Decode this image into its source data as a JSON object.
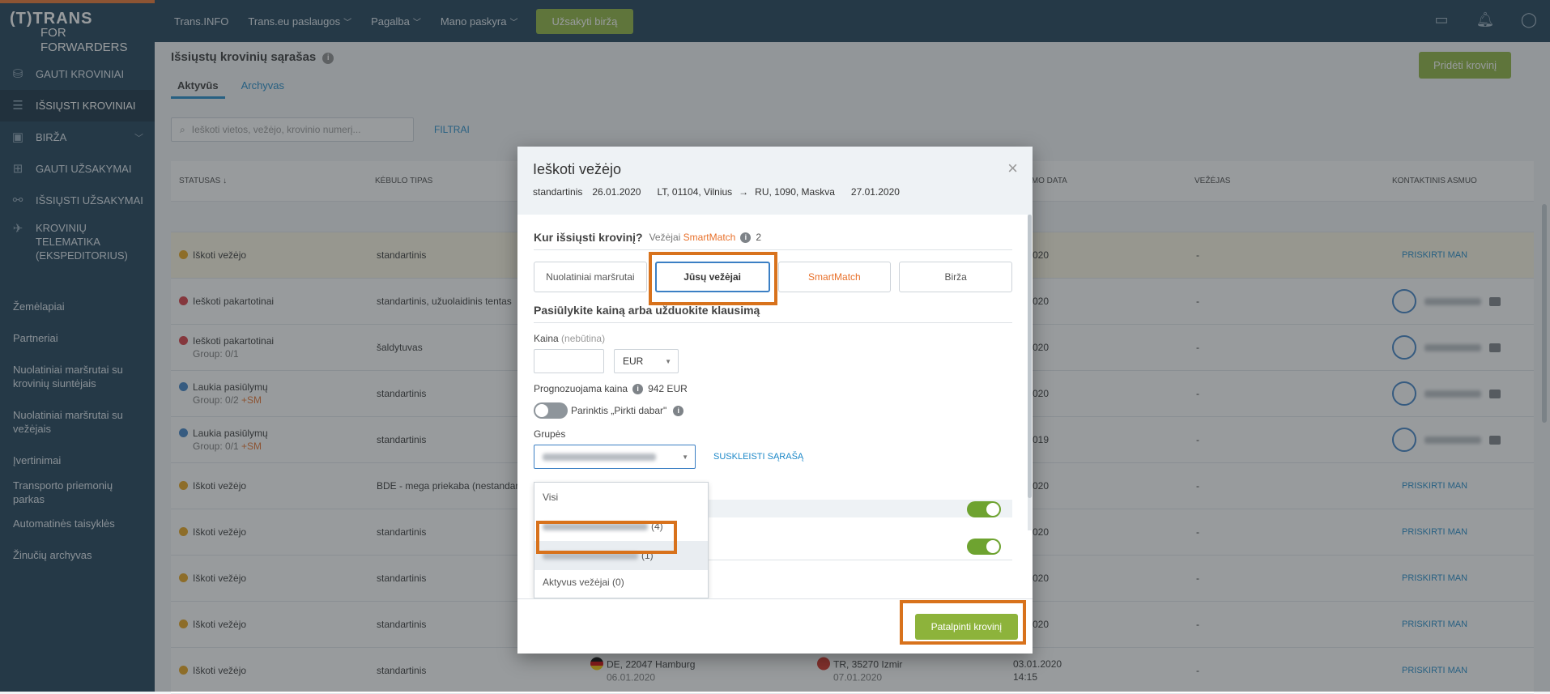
{
  "logo": {
    "line1": "(T)TRANS",
    "line2": "FOR FORWARDERS"
  },
  "topnav": {
    "items": [
      "Trans.INFO",
      "Trans.eu paslaugos",
      "Pagalba",
      "Mano paskyra"
    ],
    "order_button": "Užsakyti biržą"
  },
  "sidebar": {
    "main": [
      {
        "label": "GAUTI KROVINIAI",
        "icon": "inbox-icon"
      },
      {
        "label": "IŠSIŲSTI KROVINIAI",
        "icon": "send-icon"
      },
      {
        "label": "BIRŽA",
        "icon": "box-icon"
      },
      {
        "label": "GAUTI UŽSAKYMAI",
        "icon": "grid-icon"
      },
      {
        "label": "IŠSIŲSTI UŽSAKYMAI",
        "icon": "link-icon"
      },
      {
        "label": "KROVINIŲ TELEMATIKA (EKSPEDITORIUS)",
        "icon": "satellite-icon"
      }
    ],
    "secondary": [
      "Žemėlapiai",
      "Partneriai",
      "Nuolatiniai maršrutai su krovinių siuntėjais",
      "Nuolatiniai maršrutai su vežėjais",
      "Įvertinimai",
      "Transporto priemonių parkas",
      "Automatinės taisyklės",
      "Žinučių archyvas"
    ]
  },
  "page": {
    "title": "Išsiųstų krovinių sąrašas",
    "add_button": "Pridėti krovinį",
    "tabs": [
      "Aktyvūs",
      "Archyvas"
    ],
    "search_placeholder": "Ieškoti vietos, vežėjo, krovinio numerį...",
    "filters": "FILTRAI"
  },
  "table": {
    "headers": [
      "STATUSAS ↓",
      "KĖBULO TIPAS",
      "IMO DATA",
      "VEŽĖJAS",
      "KONTAKTINIS ASMUO"
    ],
    "rows": [
      {
        "status": "Iškoti vežėjo",
        "sub": "",
        "sm": "",
        "type": "standartinis",
        "date": "020",
        "carrier": "-",
        "contact": "PRISKIRTI MAN"
      },
      {
        "status": "Ieškoti pakartotinai",
        "sub": "",
        "sm": "",
        "type": "standartinis, užuolaidinis tentas",
        "date": "020",
        "carrier": "-",
        "contact": ""
      },
      {
        "status": "Ieškoti pakartotinai",
        "sub": "Group: 0/1",
        "sm": "",
        "type": "šaldytuvas",
        "date": "020",
        "carrier": "-",
        "contact": ""
      },
      {
        "status": "Laukia pasiūlymų",
        "sub": "Group: 0/2",
        "sm": "+SM",
        "type": "standartinis",
        "date": "020",
        "carrier": "-",
        "contact": ""
      },
      {
        "status": "Laukia pasiūlymų",
        "sub": "Group: 0/1",
        "sm": "+SM",
        "type": "standartinis",
        "date": "019",
        "carrier": "-",
        "contact": ""
      },
      {
        "status": "Iškoti vežėjo",
        "sub": "",
        "sm": "",
        "type": "BDE - mega priekaba (nestandar",
        "date": "020",
        "carrier": "-",
        "contact": "PRISKIRTI MAN"
      },
      {
        "status": "Iškoti vežėjo",
        "sub": "",
        "sm": "",
        "type": "standartinis",
        "date": "020",
        "carrier": "-",
        "contact": "PRISKIRTI MAN"
      },
      {
        "status": "Iškoti vežėjo",
        "sub": "",
        "sm": "",
        "type": "standartinis",
        "date": "020",
        "carrier": "-",
        "contact": "PRISKIRTI MAN"
      },
      {
        "status": "Iškoti vežėjo",
        "sub": "",
        "sm": "",
        "type": "standartinis",
        "date": "020",
        "carrier": "-",
        "contact": "PRISKIRTI MAN"
      },
      {
        "status": "Iškoti vežėjo",
        "sub": "",
        "sm": "",
        "type": "standartinis",
        "date": "03.01.2020",
        "date2": "14:15",
        "carrier": "-",
        "contact": "PRISKIRTI MAN",
        "from": "DE, 22047 Hamburg",
        "from_date": "06.01.2020",
        "to": "TR, 35270 Izmir",
        "to_date": "07.01.2020"
      }
    ]
  },
  "modal": {
    "title": "Ieškoti vežėjo",
    "route": {
      "type": "standartinis",
      "date_from": "26.01.2020",
      "from": "LT, 01104, Vilnius",
      "arrow": "→",
      "to": "RU, 1090, Maskva",
      "date_to": "27.01.2020"
    },
    "close": "×",
    "section1": {
      "title": "Kur išsiųsti krovinį?",
      "carriers_label": "Vežėjai",
      "smartmatch": "SmartMatch",
      "count": "2"
    },
    "options": [
      "Nuolatiniai maršrutai",
      "Jūsų vežėjai",
      "SmartMatch",
      "Birža"
    ],
    "section2": {
      "title": "Pasiūlykite kainą arba užduokite klausimą"
    },
    "price_label": "Kaina",
    "price_optional": "(nebūtina)",
    "currency": "EUR",
    "forecast_label": "Prognozuojama kaina",
    "forecast_value": "942 EUR",
    "buy_now_label": "Parinktis „Pirkti dabar\"",
    "groups_label": "Grupės",
    "collapse_list": "SUSKLEISTI SĄRAŠĄ",
    "dropdown": [
      {
        "label": "Visi",
        "count": ""
      },
      {
        "label": "",
        "count": "(4)"
      },
      {
        "label": "",
        "count": "(1)"
      },
      {
        "label": "Aktyvus vežėjai (0)",
        "count": ""
      }
    ],
    "place_button": "Patalpinti krovinį"
  },
  "colors": {
    "accent_green": "#8db33b",
    "callout_orange": "#d8721c",
    "link_blue": "#1c88c8",
    "sidebar": "#193b53"
  }
}
